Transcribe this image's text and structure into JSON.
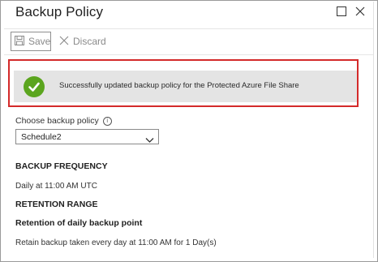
{
  "window": {
    "title": "Backup Policy",
    "controls": {
      "restore_icon": "restore-icon",
      "close_icon": "close-icon"
    }
  },
  "toolbar": {
    "save_label": "Save",
    "save_icon": "save-icon",
    "discard_label": "Discard",
    "discard_icon": "discard-icon"
  },
  "notification": {
    "message": "Successfully updated backup policy for the Protected Azure File Share",
    "icon": "checkmark-icon",
    "icon_color": "#5ba51e",
    "highlight_color": "#d42a2a"
  },
  "policy": {
    "label": "Choose backup policy",
    "selected": "Schedule2"
  },
  "details": {
    "frequency_heading": "BACKUP FREQUENCY",
    "frequency_value": "Daily at 11:00 AM UTC",
    "retention_heading": "RETENTION RANGE",
    "daily_heading": "Retention of daily backup point",
    "daily_value": "Retain backup taken every day at 11:00 AM for 1 Day(s)"
  }
}
